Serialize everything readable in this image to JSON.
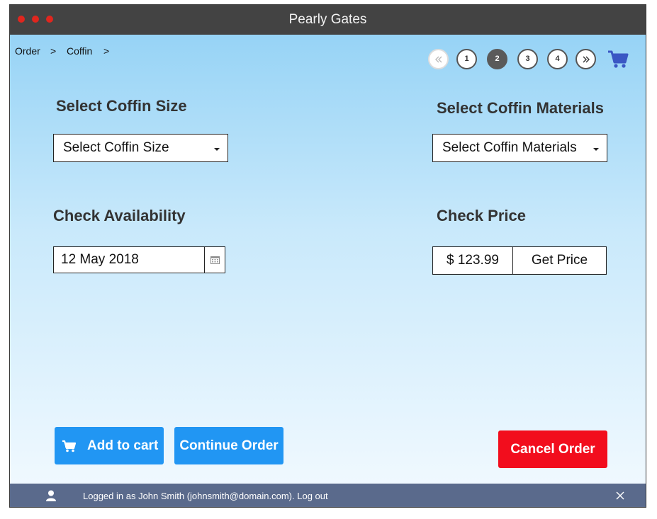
{
  "window": {
    "title": "Pearly Gates",
    "traffic_light_color": "#e0261e"
  },
  "breadcrumb": {
    "items": [
      "Order",
      "Coffin"
    ],
    "separator": ">"
  },
  "pager": {
    "first_icon": "double-chevron-left-icon",
    "pages": [
      "1",
      "2",
      "3",
      "4"
    ],
    "active_page": "2",
    "last_icon": "double-chevron-right-icon"
  },
  "cart": {
    "icon": "shopping-cart-icon",
    "color": "#3a57c4"
  },
  "size": {
    "heading": "Select Coffin Size",
    "placeholder": "Select Coffin Size"
  },
  "materials": {
    "heading": "Select Coffin Materials",
    "placeholder": "Select Coffin Materials"
  },
  "availability": {
    "heading": "Check Availability",
    "date": "12 May 2018",
    "icon": "calendar-icon"
  },
  "price": {
    "heading": "Check Price",
    "value": "$ 123.99",
    "button": "Get Price"
  },
  "actions": {
    "add_to_cart": "Add to cart",
    "continue": "Continue Order",
    "cancel": "Cancel Order",
    "accent": "#2196f3",
    "danger": "#f20d1d"
  },
  "footer": {
    "text": "Logged in as John Smith (johnsmith@domain.com). Log out",
    "user_icon": "user-icon",
    "close_icon": "close-icon"
  }
}
